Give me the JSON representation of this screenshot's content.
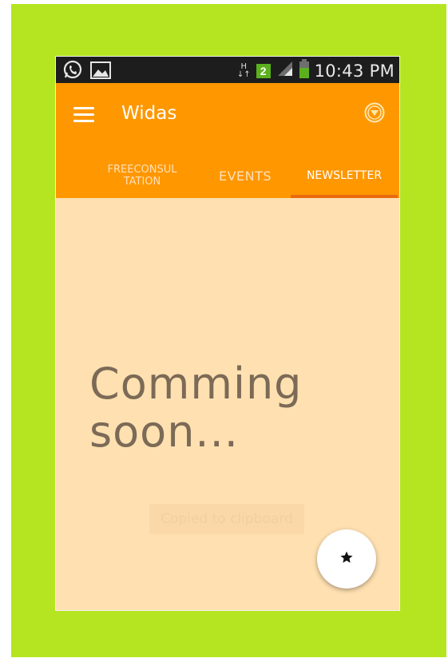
{
  "status_bar": {
    "time": "10:43 PM",
    "signal_badge": "2",
    "network_type": "H",
    "left_icons": [
      "whatsapp-icon",
      "image-icon"
    ],
    "right_icons": [
      "data-arrows-icon",
      "sim-badge-icon",
      "signal-icon",
      "battery-icon"
    ]
  },
  "app_bar": {
    "title": "Widas",
    "menu_icon": "hamburger-menu-icon",
    "overflow_icon": "dropdown-circle-icon",
    "background": "#ff9700"
  },
  "tabs": [
    {
      "label": "FREECONSUL\nTATION",
      "selected": false
    },
    {
      "label": "EVENTS",
      "selected": false
    },
    {
      "label": "NEWSLETTER",
      "selected": true
    }
  ],
  "content": {
    "message_line1": "Comming",
    "message_line2": "soon...",
    "toast": "Copied to clipboard",
    "background": "#ffe0b1"
  },
  "fab": {
    "icon": "star-icon"
  },
  "colors": {
    "frame": "#b5e520",
    "accent": "#ff9700",
    "tab_indicator": "#ea6a0d"
  }
}
